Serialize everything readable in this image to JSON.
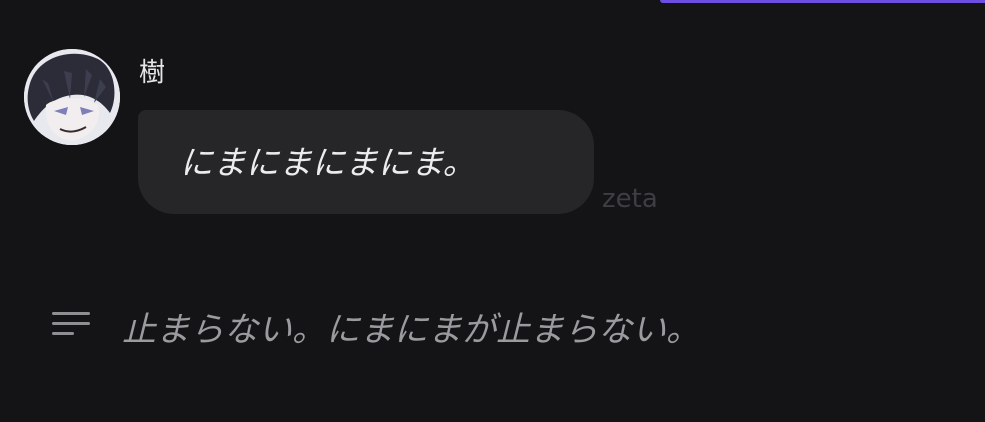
{
  "message": {
    "sender_name": "樹",
    "avatar_icon": "character-avatar",
    "text": "にまにまにまにま。",
    "watermark": "zeta"
  },
  "narration": {
    "icon": "narration-lines-icon",
    "text": "止まらない。にまにまが止まらない。"
  },
  "colors": {
    "background": "#141316",
    "bubble": "#262528",
    "accent": "#6c4ee0",
    "message_text": "#ececee",
    "narration_text": "#9b9a9f"
  }
}
